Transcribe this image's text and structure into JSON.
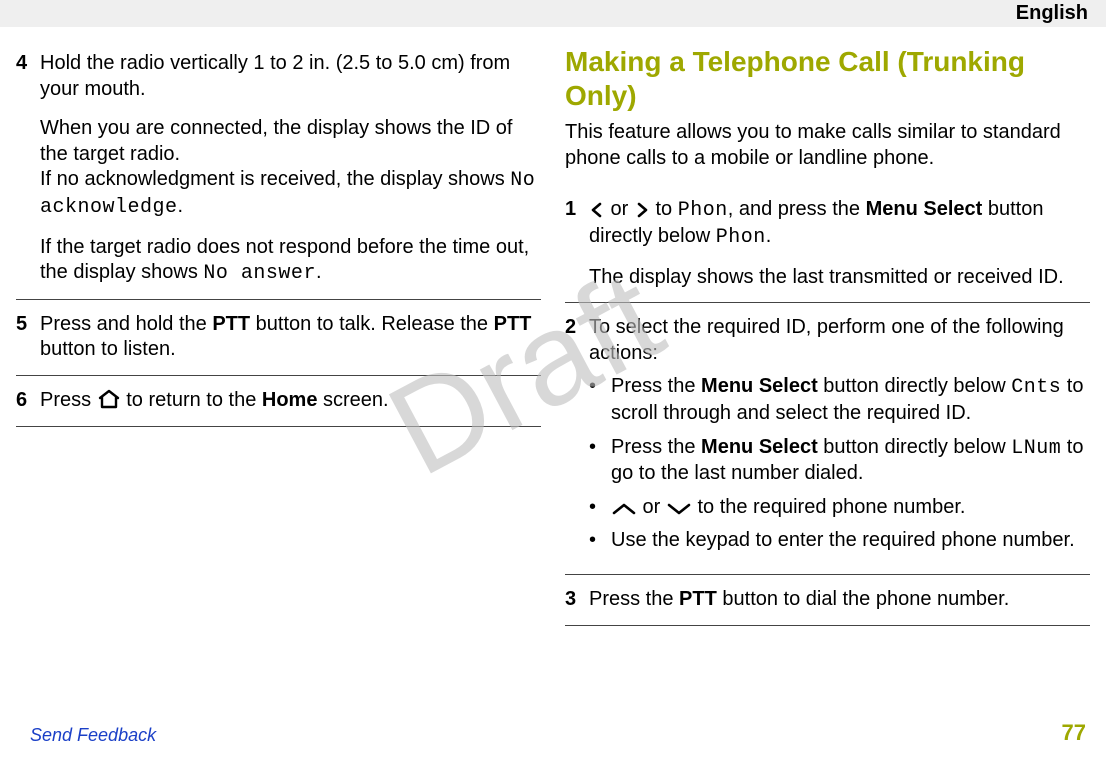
{
  "header": {
    "language": "English"
  },
  "watermark": "Draft",
  "left_column": {
    "steps": [
      {
        "num": "4",
        "p1": "Hold the radio vertically 1 to 2 in. (2.5 to 5.0 cm) from your mouth.",
        "p2a": "When you are connected, the display shows the ID of the target radio.",
        "p2b_before": "If no acknowledgment is received, the display shows ",
        "p2b_mono": "No acknowledge",
        "p2b_after": ".",
        "p3_before": "If the target radio does not respond before the time out, the display shows ",
        "p3_mono": "No answer",
        "p3_after": "."
      },
      {
        "num": "5",
        "text_before": "Press and hold the ",
        "ptt1": "PTT",
        "mid": " button to talk. Release the ",
        "ptt2": "PTT",
        "text_after": " button to listen."
      },
      {
        "num": "6",
        "before": "Press ",
        "mid": " to return to the ",
        "home": "Home",
        "after": " screen."
      }
    ]
  },
  "right_column": {
    "title": "Making a Telephone Call (Trunking Only)",
    "intro": "This feature allows you to make calls similar to standard phone calls to a mobile or landline phone.",
    "steps": [
      {
        "num": "1",
        "l1_mid": " to ",
        "phon": "Phon",
        "l1_after1": ", and press the ",
        "menu_sel": "Menu Select",
        "l1_after2": " button directly below ",
        "phon2": "Phon",
        "l1_end": ".",
        "or": " or ",
        "p2": "The display shows the last transmitted or received ID."
      },
      {
        "num": "2",
        "intro": "To select the required ID, perform one of the following actions:",
        "b1_before": "Press the ",
        "menu_sel": "Menu Select",
        "b1_mid": " button directly below ",
        "cnts": "Cnts",
        "b1_after": " to scroll through and select the required ID.",
        "b2_before": "Press the ",
        "b2_mid": " button directly below ",
        "lnum": "LNum",
        "b2_after": " to go to the last number dialed.",
        "b3_or": " or ",
        "b3_after": " to the required phone number.",
        "b4": "Use the keypad to enter the required phone number."
      },
      {
        "num": "3",
        "before": "Press the ",
        "ptt": "PTT",
        "after": " button to dial the phone number."
      }
    ]
  },
  "footer": {
    "link": "Send Feedback",
    "page": "77"
  }
}
